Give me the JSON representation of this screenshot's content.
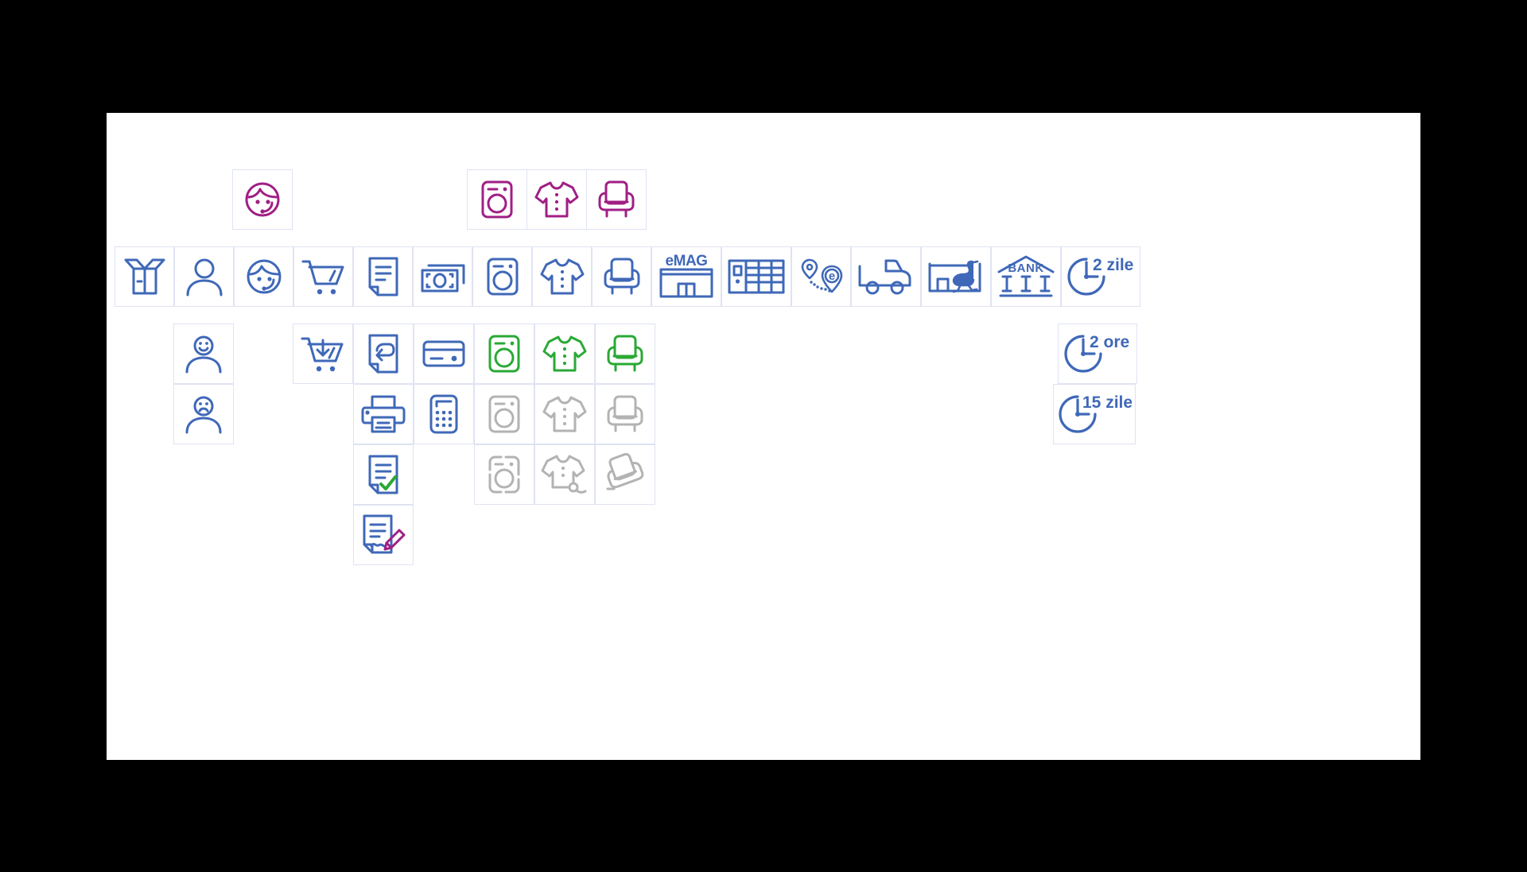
{
  "page": {
    "background": "#000000",
    "canvas_background": "#ffffff",
    "title": "eMAG icon set sheet"
  },
  "colors": {
    "blue": "#3f68b8",
    "magenta": "#a01f84",
    "green": "#2aa935",
    "grey": "#b3b3b3",
    "cell_border": "#dfe3f3"
  },
  "labels": {
    "emag": "eMAG",
    "bank": "BANK",
    "pin_e": "e",
    "clock_2_zile": "2 zile",
    "clock_2_ore": "2 ore",
    "clock_15_zile": "15 zile"
  },
  "rows": {
    "row_top": {
      "name": "magenta-accent-row",
      "cells": [
        {
          "icon": "support-agent-icon",
          "color": "#a01f84",
          "label": "Support agent"
        },
        {
          "icon": "washing-machine-icon",
          "color": "#a01f84",
          "label": "Appliance"
        },
        {
          "icon": "tshirt-icon",
          "color": "#a01f84",
          "label": "Fashion"
        },
        {
          "icon": "armchair-icon",
          "color": "#a01f84",
          "label": "Furniture"
        }
      ]
    },
    "row_main": {
      "name": "primary-blue-row",
      "cells": [
        {
          "icon": "open-box-icon",
          "color": "#3f68b8",
          "label": "Open box"
        },
        {
          "icon": "user-icon",
          "color": "#3f68b8",
          "label": "User"
        },
        {
          "icon": "support-agent-icon",
          "color": "#3f68b8",
          "label": "Support agent"
        },
        {
          "icon": "shopping-cart-icon",
          "color": "#3f68b8",
          "label": "Shopping cart"
        },
        {
          "icon": "document-icon",
          "color": "#3f68b8",
          "label": "Document"
        },
        {
          "icon": "banknotes-icon",
          "color": "#3f68b8",
          "label": "Cash"
        },
        {
          "icon": "washing-machine-icon",
          "color": "#3f68b8",
          "label": "Appliance"
        },
        {
          "icon": "tshirt-icon",
          "color": "#3f68b8",
          "label": "Fashion"
        },
        {
          "icon": "armchair-icon",
          "color": "#3f68b8",
          "label": "Furniture"
        },
        {
          "icon": "emag-store-icon",
          "color": "#3f68b8",
          "label": "eMAG store"
        },
        {
          "icon": "parcel-locker-icon",
          "color": "#3f68b8",
          "label": "Easybox locker"
        },
        {
          "icon": "map-pins-route-icon",
          "color": "#3f68b8",
          "label": "Delivery route"
        },
        {
          "icon": "delivery-truck-icon",
          "color": "#3f68b8",
          "label": "Courier truck"
        },
        {
          "icon": "sameday-ostrich-icon",
          "color": "#3f68b8",
          "label": "Sameday courier"
        },
        {
          "icon": "bank-icon",
          "color": "#3f68b8",
          "label": "Bank"
        },
        {
          "icon": "clock-2-zile-icon",
          "color": "#3f68b8",
          "label": "2 zile"
        }
      ]
    },
    "row_states": {
      "name": "state-variant-rows",
      "cells": [
        {
          "icon": "user-happy-icon",
          "color": "#3f68b8",
          "label": "Happy customer"
        },
        {
          "icon": "user-sad-icon",
          "color": "#3f68b8",
          "label": "Unhappy customer"
        },
        {
          "icon": "cart-download-icon",
          "color": "#3f68b8",
          "label": "Add to cart"
        },
        {
          "icon": "document-return-icon",
          "color": "#3f68b8",
          "label": "Return request"
        },
        {
          "icon": "credit-card-icon",
          "color": "#3f68b8",
          "label": "Card payment"
        },
        {
          "icon": "washing-machine-icon",
          "color": "#2aa935",
          "label": "Appliance available"
        },
        {
          "icon": "tshirt-icon",
          "color": "#2aa935",
          "label": "Fashion available"
        },
        {
          "icon": "armchair-icon",
          "color": "#2aa935",
          "label": "Furniture available"
        },
        {
          "icon": "printer-icon",
          "color": "#3f68b8",
          "label": "Print"
        },
        {
          "icon": "calculator-icon",
          "color": "#3f68b8",
          "label": "Calculator"
        },
        {
          "icon": "washing-machine-icon",
          "color": "#b3b3b3",
          "label": "Appliance unavailable"
        },
        {
          "icon": "tshirt-icon",
          "color": "#b3b3b3",
          "label": "Fashion unavailable"
        },
        {
          "icon": "armchair-icon",
          "color": "#b3b3b3",
          "label": "Furniture unavailable"
        },
        {
          "icon": "document-approved-icon",
          "color": "#3f68b8",
          "label": "Approved document"
        },
        {
          "icon": "washing-machine-damaged-icon",
          "color": "#b3b3b3",
          "label": "Appliance damaged"
        },
        {
          "icon": "tshirt-damaged-icon",
          "color": "#b3b3b3",
          "label": "Fashion damaged"
        },
        {
          "icon": "armchair-damaged-icon",
          "color": "#b3b3b3",
          "label": "Furniture damaged"
        },
        {
          "icon": "document-sign-icon",
          "color": "#3f68b8",
          "label": "Sign document"
        },
        {
          "icon": "clock-2-ore-icon",
          "color": "#3f68b8",
          "label": "2 ore"
        },
        {
          "icon": "clock-15-zile-icon",
          "color": "#3f68b8",
          "label": "15 zile"
        }
      ]
    }
  }
}
